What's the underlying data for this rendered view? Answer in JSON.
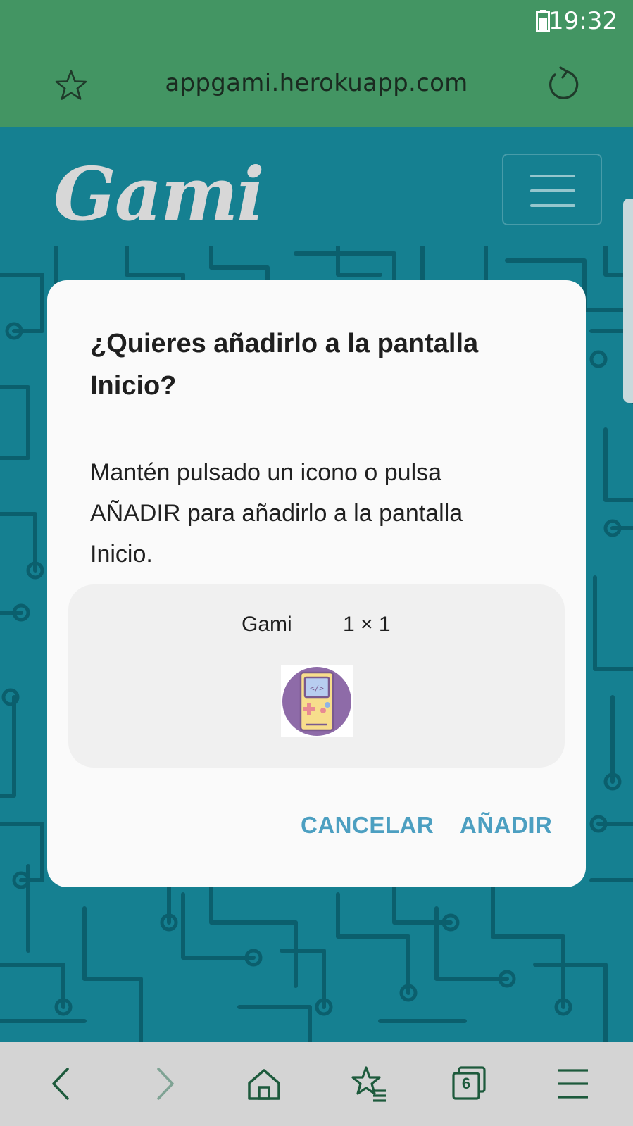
{
  "status_bar": {
    "time": "19:32"
  },
  "address_bar": {
    "url": "appgami.herokuapp.com"
  },
  "page": {
    "logo": "Gami"
  },
  "dialog": {
    "title": "¿Quieres añadirlo a la pantalla Inicio?",
    "message": "Mantén pulsado un icono o pulsa AÑADIR para añadirlo a la pantalla Inicio.",
    "app_name": "Gami",
    "app_size": "1 × 1",
    "cancel_label": "CANCELAR",
    "add_label": "AÑADIR"
  },
  "bottom_bar": {
    "tabs_count": "6"
  },
  "colors": {
    "browser_bar": "#439563",
    "page_background": "#158091",
    "dialog_button": "#4c9fc1",
    "toolbar": "#d4d4d4"
  },
  "icons": [
    "battery-icon",
    "star-icon",
    "reload-icon",
    "menu-icon",
    "back-icon",
    "forward-icon",
    "home-icon",
    "bookmarks-icon",
    "tabs-icon",
    "more-menu-icon"
  ]
}
